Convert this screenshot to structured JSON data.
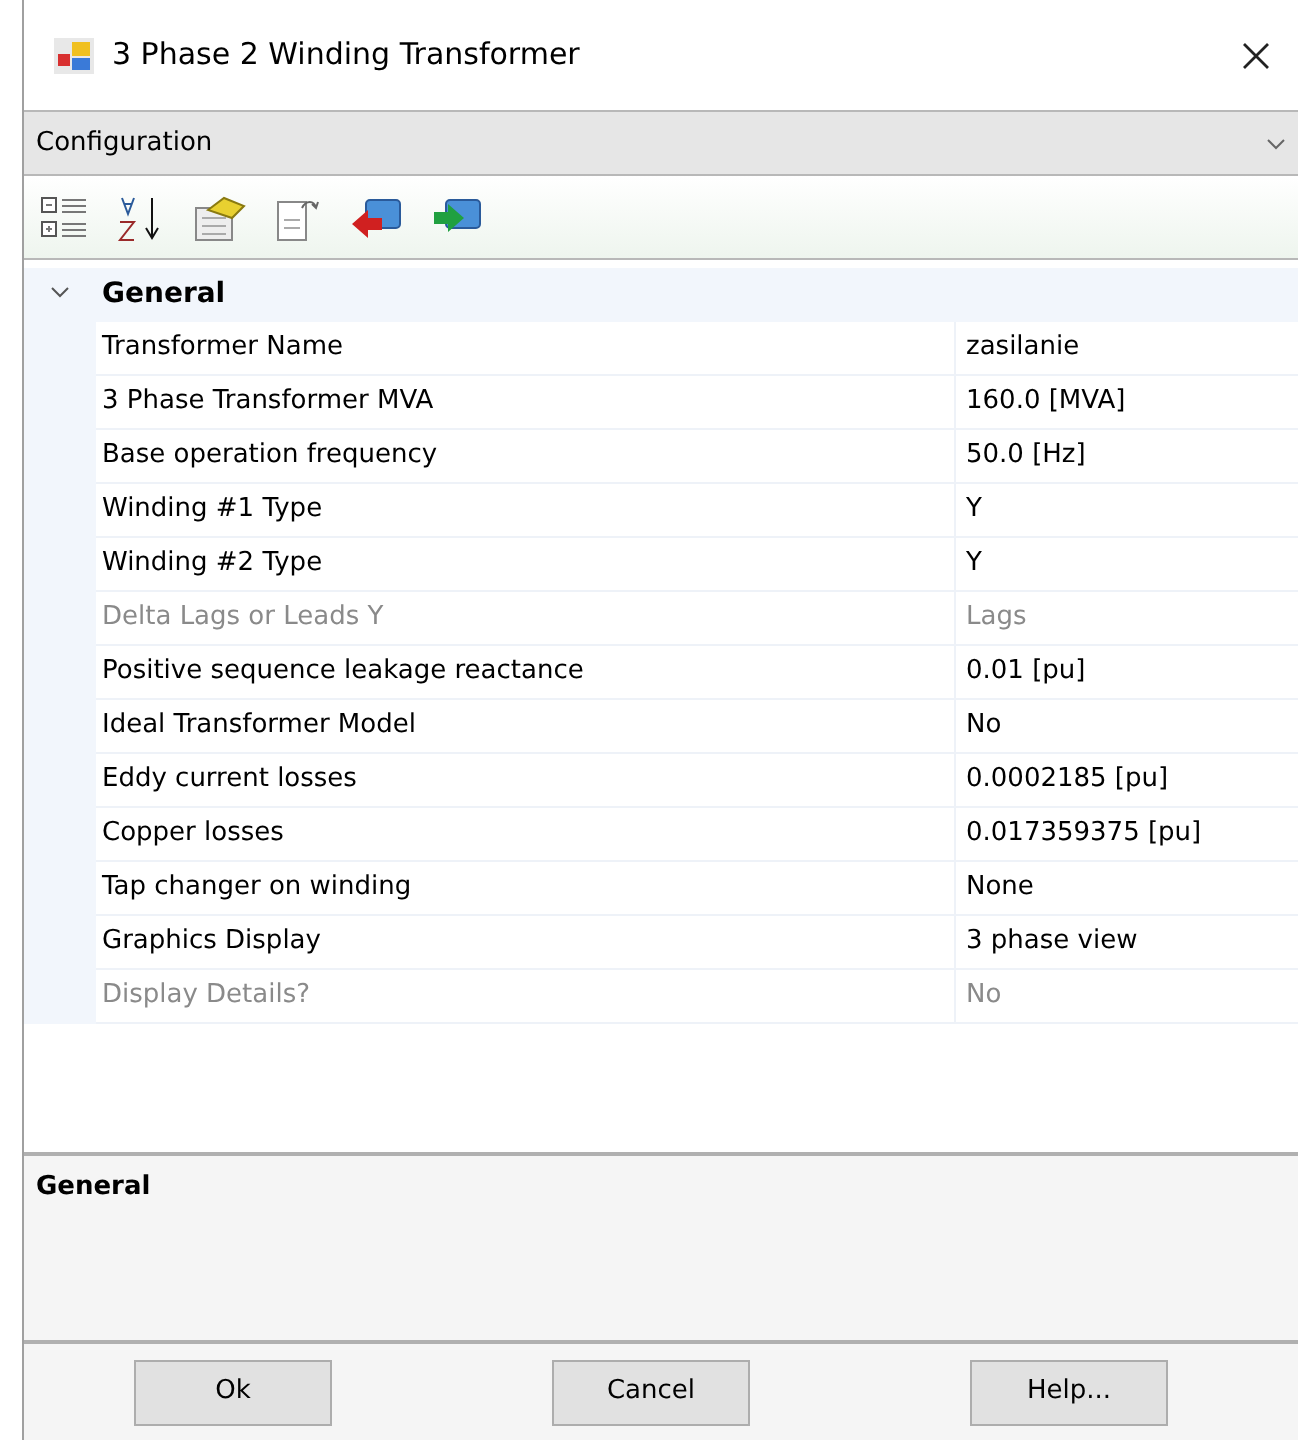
{
  "window": {
    "title": "3 Phase 2 Winding Transformer"
  },
  "category_dropdown": {
    "value": "Configuration"
  },
  "property_grid": {
    "groups": [
      {
        "title": "General",
        "expanded": true,
        "properties": [
          {
            "name": "Transformer Name",
            "value": "zasilanie",
            "disabled": false
          },
          {
            "name": "3 Phase Transformer MVA",
            "value": "160.0 [MVA]",
            "disabled": false
          },
          {
            "name": "Base operation frequency",
            "value": "50.0 [Hz]",
            "disabled": false
          },
          {
            "name": "Winding #1 Type",
            "value": "Y",
            "disabled": false
          },
          {
            "name": "Winding #2 Type",
            "value": "Y",
            "disabled": false
          },
          {
            "name": "Delta Lags or Leads Y",
            "value": "Lags",
            "disabled": true
          },
          {
            "name": "Positive sequence leakage reactance",
            "value": "0.01 [pu]",
            "disabled": false
          },
          {
            "name": "Ideal Transformer Model",
            "value": "No",
            "disabled": false
          },
          {
            "name": "Eddy current losses",
            "value": "0.0002185 [pu]",
            "disabled": false
          },
          {
            "name": "Copper losses",
            "value": "0.017359375 [pu]",
            "disabled": false
          },
          {
            "name": "Tap changer on winding",
            "value": "None",
            "disabled": false
          },
          {
            "name": "Graphics Display",
            "value": "3 phase view",
            "disabled": false
          },
          {
            "name": "Display Details?",
            "value": "No",
            "disabled": true
          }
        ]
      }
    ]
  },
  "description_panel": {
    "title": "General"
  },
  "buttons": [
    "Ok",
    "Cancel",
    "Help..."
  ]
}
